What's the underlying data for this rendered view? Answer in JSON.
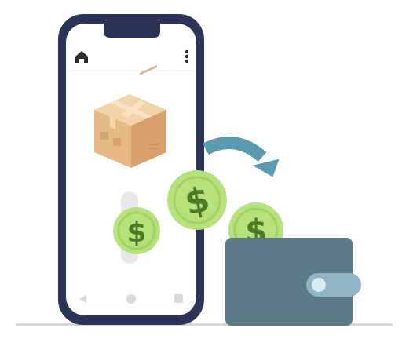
{
  "illustration": {
    "colors": {
      "background": "#ffffff",
      "phone_frame": "#2b3458",
      "phone_screen": "#ffffff",
      "icon_dark": "#2b2b2b",
      "nav_buttons": "#d9d9d9",
      "box_side_front": "#e7b985",
      "box_side_right": "#d7a06c",
      "box_top": "#f3d2a7",
      "box_tape": "#f7e4c6",
      "coin_fill": "#b5e27a",
      "coin_ring": "#a4d166",
      "coin_symbol": "#4a7a2a",
      "arrow": "#5a9bb2",
      "wallet_body": "#5a7a88",
      "wallet_clasp": "#8fb5c6",
      "wallet_button": "#d9ecf3",
      "ground_shadow": "#d6d6d6",
      "slot": "#e8e8e8"
    },
    "coin_symbol": "$",
    "icons": {
      "home": "home-icon",
      "menu": "more-vertical-icon",
      "back": "back-triangle-icon",
      "home_nav": "home-circle-icon",
      "recent": "recent-square-icon"
    }
  }
}
